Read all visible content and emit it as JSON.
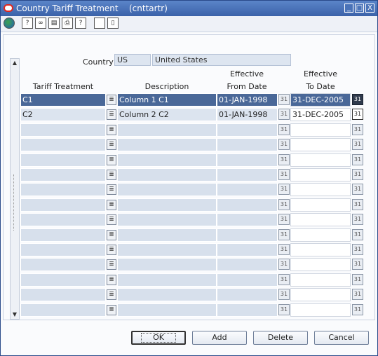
{
  "window": {
    "title": "Country Tariff Treatment",
    "code": "(cnttartr)",
    "controls": [
      "_",
      "□",
      "X"
    ]
  },
  "toolbar": {
    "items": [
      "globe-icon",
      "help-icon",
      "binoculars-icon",
      "notes-icon",
      "print-icon",
      "question-icon",
      "blank-icon",
      "document-icon"
    ]
  },
  "form": {
    "country_label": "Country",
    "country_code": "US",
    "country_name": "United States"
  },
  "table": {
    "headers": {
      "tariff_treatment": "Tariff Treatment",
      "description": "Description",
      "effective_from_1": "Effective",
      "effective_from_2": "From Date",
      "effective_to_1": "Effective",
      "effective_to_2": "To Date"
    },
    "rows": [
      {
        "tariff": "C1",
        "description": "Column 1 C1",
        "from": "01-JAN-1998",
        "to": "31-DEC-2005"
      },
      {
        "tariff": "C2",
        "description": "Column 2 C2",
        "from": "01-JAN-1998",
        "to": "31-DEC-2005"
      },
      {
        "tariff": "",
        "description": "",
        "from": "",
        "to": ""
      },
      {
        "tariff": "",
        "description": "",
        "from": "",
        "to": ""
      },
      {
        "tariff": "",
        "description": "",
        "from": "",
        "to": ""
      },
      {
        "tariff": "",
        "description": "",
        "from": "",
        "to": ""
      },
      {
        "tariff": "",
        "description": "",
        "from": "",
        "to": ""
      },
      {
        "tariff": "",
        "description": "",
        "from": "",
        "to": ""
      },
      {
        "tariff": "",
        "description": "",
        "from": "",
        "to": ""
      },
      {
        "tariff": "",
        "description": "",
        "from": "",
        "to": ""
      },
      {
        "tariff": "",
        "description": "",
        "from": "",
        "to": ""
      },
      {
        "tariff": "",
        "description": "",
        "from": "",
        "to": ""
      },
      {
        "tariff": "",
        "description": "",
        "from": "",
        "to": ""
      },
      {
        "tariff": "",
        "description": "",
        "from": "",
        "to": ""
      },
      {
        "tariff": "",
        "description": "",
        "from": "",
        "to": ""
      }
    ],
    "editor_icon": "≣",
    "calendar_icon": "31"
  },
  "buttons": {
    "ok": "OK",
    "add": "Add",
    "delete": "Delete",
    "cancel": "Cancel"
  }
}
